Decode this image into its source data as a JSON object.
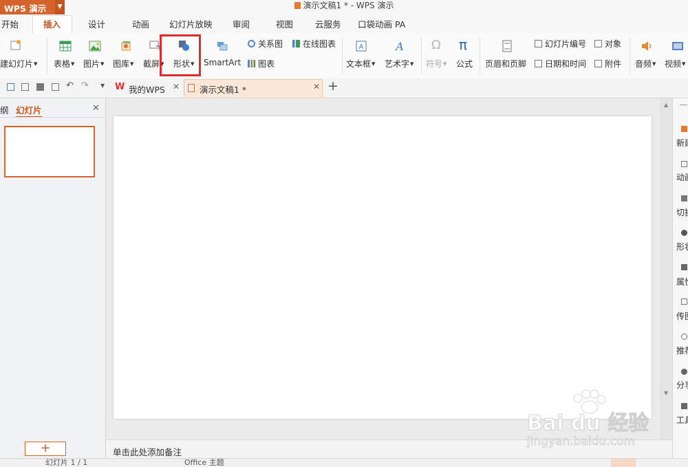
{
  "app": {
    "name": "WPS 演示",
    "brand_color": "#d4642b"
  },
  "window": {
    "title": "演示文稿1 * - WPS 演示"
  },
  "tabs": [
    {
      "label": "开始"
    },
    {
      "label": "插入",
      "active": true
    },
    {
      "label": "设计"
    },
    {
      "label": "动画"
    },
    {
      "label": "幻灯片放映"
    },
    {
      "label": "审阅"
    },
    {
      "label": "视图"
    },
    {
      "label": "云服务"
    },
    {
      "label": "口袋动画 PA"
    }
  ],
  "ribbon": {
    "new_slide": "建幻灯片",
    "table": "表格",
    "picture": "图片",
    "gallery": "图库",
    "screenshot": "截屏",
    "shape": "形状",
    "smartart": "SmartArt",
    "relation_chart": "关系图",
    "online_chart": "在线图表",
    "chart": "图表",
    "textbox": "文本框",
    "wordart": "艺术字",
    "symbol": "符号",
    "formula": "公式",
    "header_footer": "页眉和页脚",
    "slide_number": "幻灯片编号",
    "object": "对象",
    "date_time": "日期和时间",
    "attachment": "附件",
    "audio": "音频",
    "video": "视频"
  },
  "doc_tabs": [
    {
      "label": "我的WPS"
    },
    {
      "label": "演示文稿1 *",
      "active": true
    }
  ],
  "left_panel": {
    "tab_outline": "纲",
    "tab_slides": "幻灯片"
  },
  "notes_placeholder": "单击此处添加备注",
  "right_panel": [
    "新建",
    "动画",
    "切换",
    "形状",
    "属性",
    "传图",
    "推荐",
    "分享",
    "工具"
  ],
  "status": {
    "slide_info": "幻灯片 1 / 1",
    "theme": "Office 主题"
  },
  "watermark": {
    "brand": "Bai du 经验",
    "url": "jingyan.baidu.com"
  }
}
